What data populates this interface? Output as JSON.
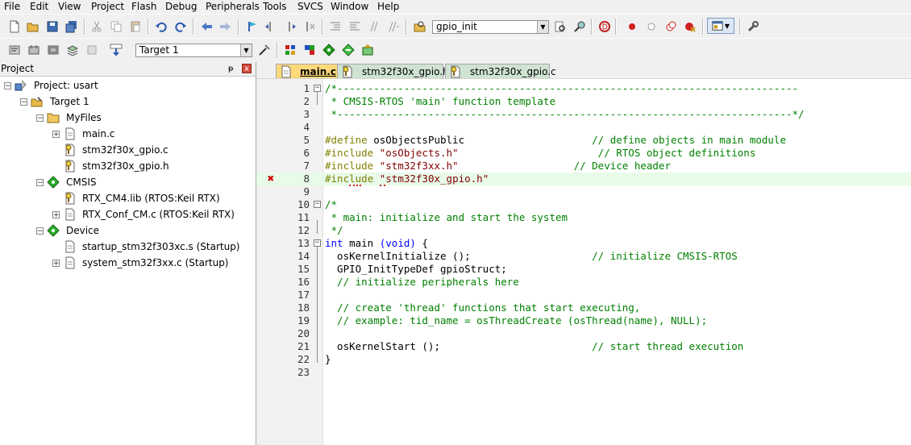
{
  "menu": [
    "File",
    "Edit",
    "View",
    "Project",
    "Flash",
    "Debug",
    "Peripherals",
    "Tools",
    "SVCS",
    "Window",
    "Help"
  ],
  "toolbar": {
    "find_combo_value": "gpio_init",
    "target_combo_value": "Target 1"
  },
  "project_panel": {
    "title": "Project",
    "pin_glyph": "ᵽ",
    "close_glyph": "x",
    "tree": [
      {
        "label": "Project: usart",
        "icon": "project-icon",
        "expander": "−",
        "level": 0
      },
      {
        "label": "Target 1",
        "icon": "target-icon",
        "expander": "−",
        "level": 1
      },
      {
        "label": "MyFiles",
        "icon": "folder-icon",
        "expander": "−",
        "level": 2
      },
      {
        "label": "main.c",
        "icon": "c-file-icon",
        "expander": "+",
        "level": 3
      },
      {
        "label": "stm32f30x_gpio.c",
        "icon": "c-file-key-icon",
        "expander": "",
        "level": 3
      },
      {
        "label": "stm32f30x_gpio.h",
        "icon": "h-file-key-icon",
        "expander": "",
        "level": 3
      },
      {
        "label": "CMSIS",
        "icon": "component-icon",
        "expander": "−",
        "level": 2
      },
      {
        "label": "RTX_CM4.lib (RTOS:Keil RTX)",
        "icon": "lib-file-key-icon",
        "expander": "",
        "level": 3
      },
      {
        "label": "RTX_Conf_CM.c (RTOS:Keil RTX)",
        "icon": "c-file-icon",
        "expander": "+",
        "level": 3
      },
      {
        "label": "Device",
        "icon": "component-icon",
        "expander": "−",
        "level": 2
      },
      {
        "label": "startup_stm32f303xc.s (Startup)",
        "icon": "s-file-icon",
        "expander": "",
        "level": 3
      },
      {
        "label": "system_stm32f3xx.c (Startup)",
        "icon": "c-file-icon",
        "expander": "+",
        "level": 3
      }
    ]
  },
  "tabs": [
    {
      "label": "main.c",
      "active": true
    },
    {
      "label": "stm32f30x_gpio.h",
      "active": false
    },
    {
      "label": "stm32f30x_gpio.c",
      "active": false
    }
  ],
  "editor": {
    "lines": [
      {
        "n": "1",
        "fold": "−",
        "segs": [
          {
            "c": "c-cm",
            "t": "/*----------------------------------------------------------------------------"
          }
        ]
      },
      {
        "n": "2",
        "segs": [
          {
            "c": "c-cm",
            "t": " * CMSIS-RTOS 'main' function template"
          }
        ]
      },
      {
        "n": "3",
        "segs": [
          {
            "c": "c-cm",
            "t": " *---------------------------------------------------------------------------*/"
          }
        ]
      },
      {
        "n": "4",
        "segs": []
      },
      {
        "n": "5",
        "segs": [
          {
            "c": "c-pp",
            "t": "#define "
          },
          {
            "c": "c-pl",
            "t": "osObjectsPublic                     "
          },
          {
            "c": "c-cm",
            "t": "// define objects in main module"
          }
        ]
      },
      {
        "n": "6",
        "segs": [
          {
            "c": "c-pp",
            "t": "#include "
          },
          {
            "c": "c-st",
            "t": "\"osObjects.h\"                       "
          },
          {
            "c": "c-cm",
            "t": "// RTOS object definitions"
          }
        ]
      },
      {
        "n": "7",
        "segs": [
          {
            "c": "c-pp",
            "t": "#include "
          },
          {
            "c": "c-st",
            "t": "\"stm32f3xx.h\"                   "
          },
          {
            "c": "c-cm",
            "t": "// Device header"
          }
        ]
      },
      {
        "n": "8",
        "err": true,
        "segs": [
          {
            "c": "c-pp",
            "t": "#inc"
          },
          {
            "c": "c-pp err-squiggle",
            "t": "lu"
          },
          {
            "c": "c-pp",
            "t": "de "
          },
          {
            "c": "c-st err-squiggle",
            "t": "\""
          },
          {
            "c": "c-st",
            "t": "stm32f30x_gpio.h\""
          }
        ]
      },
      {
        "n": "9",
        "segs": []
      },
      {
        "n": "10",
        "fold": "−",
        "segs": [
          {
            "c": "c-cm",
            "t": "/*"
          }
        ]
      },
      {
        "n": "11",
        "segs": [
          {
            "c": "c-cm",
            "t": " * main: initialize and start the system"
          }
        ]
      },
      {
        "n": "12",
        "segs": [
          {
            "c": "c-cm",
            "t": " */"
          }
        ]
      },
      {
        "n": "13",
        "fold": "−",
        "segs": [
          {
            "c": "c-kw",
            "t": "int "
          },
          {
            "c": "c-pl",
            "t": "main "
          },
          {
            "c": "c-kw",
            "t": "(void)"
          },
          {
            "c": "c-pl",
            "t": " {"
          }
        ]
      },
      {
        "n": "14",
        "segs": [
          {
            "c": "c-pl",
            "t": "  osKernelInitialize ();                    "
          },
          {
            "c": "c-cm",
            "t": "// initialize CMSIS-RTOS"
          }
        ]
      },
      {
        "n": "15",
        "segs": [
          {
            "c": "c-pl",
            "t": "  GPIO_InitTypeDef gpioStruct;"
          }
        ]
      },
      {
        "n": "16",
        "segs": [
          {
            "c": "c-cm",
            "t": "  // initialize peripherals here"
          }
        ]
      },
      {
        "n": "17",
        "segs": []
      },
      {
        "n": "18",
        "segs": [
          {
            "c": "c-cm",
            "t": "  // create 'thread' functions that start executing,"
          }
        ]
      },
      {
        "n": "19",
        "segs": [
          {
            "c": "c-cm",
            "t": "  // example: tid_name = osThreadCreate (osThread(name), NULL);"
          }
        ]
      },
      {
        "n": "20",
        "segs": []
      },
      {
        "n": "21",
        "segs": [
          {
            "c": "c-pl",
            "t": "  osKernelStart ();                         "
          },
          {
            "c": "c-cm",
            "t": "// start thread execution"
          }
        ]
      },
      {
        "n": "22",
        "segs": [
          {
            "c": "c-pl",
            "t": "}"
          }
        ]
      },
      {
        "n": "23",
        "segs": []
      }
    ],
    "error_glyph": "✖"
  },
  "colors": {
    "active_tab": "#fdd97a",
    "inactive_tab": "#cfe3d2",
    "comment": "#008000",
    "preprocessor": "#808000",
    "keyword": "#0000ff",
    "string": "#800000",
    "current_line": "#e8fbe8"
  }
}
